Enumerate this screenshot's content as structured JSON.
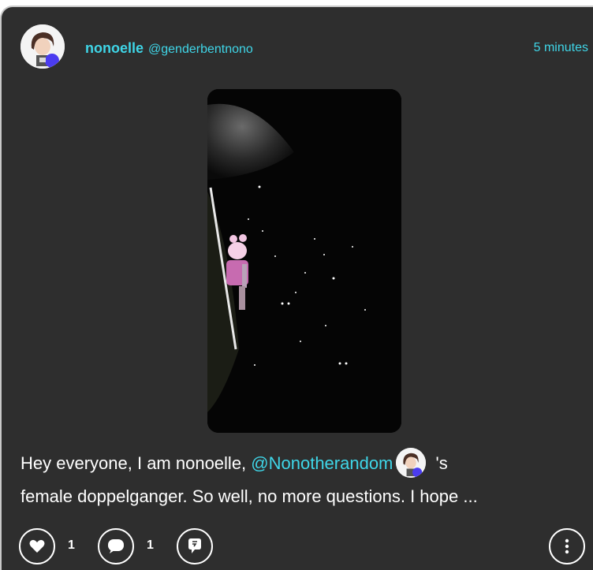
{
  "post": {
    "display_name": "nonoelle",
    "handle": "@genderbentnono",
    "timestamp": "5 minutes",
    "text_part1": "Hey everyone, I am nonoelle, ",
    "mention": "@Nonotherandom",
    "text_part2": " 's",
    "text_line2": "female doppelganger. So well, no more questions.  I hope ...",
    "media_kind": "game-screenshot"
  },
  "actions": {
    "like_count": "1",
    "comment_count": "1",
    "like_icon": "heart-icon",
    "comment_icon": "speech-bubble-icon",
    "share_icon": "repost-icon",
    "more_icon": "vertical-ellipsis-icon"
  },
  "colors": {
    "background": "#2e2e2e",
    "accent": "#3fd6e8",
    "text": "#ffffff"
  }
}
